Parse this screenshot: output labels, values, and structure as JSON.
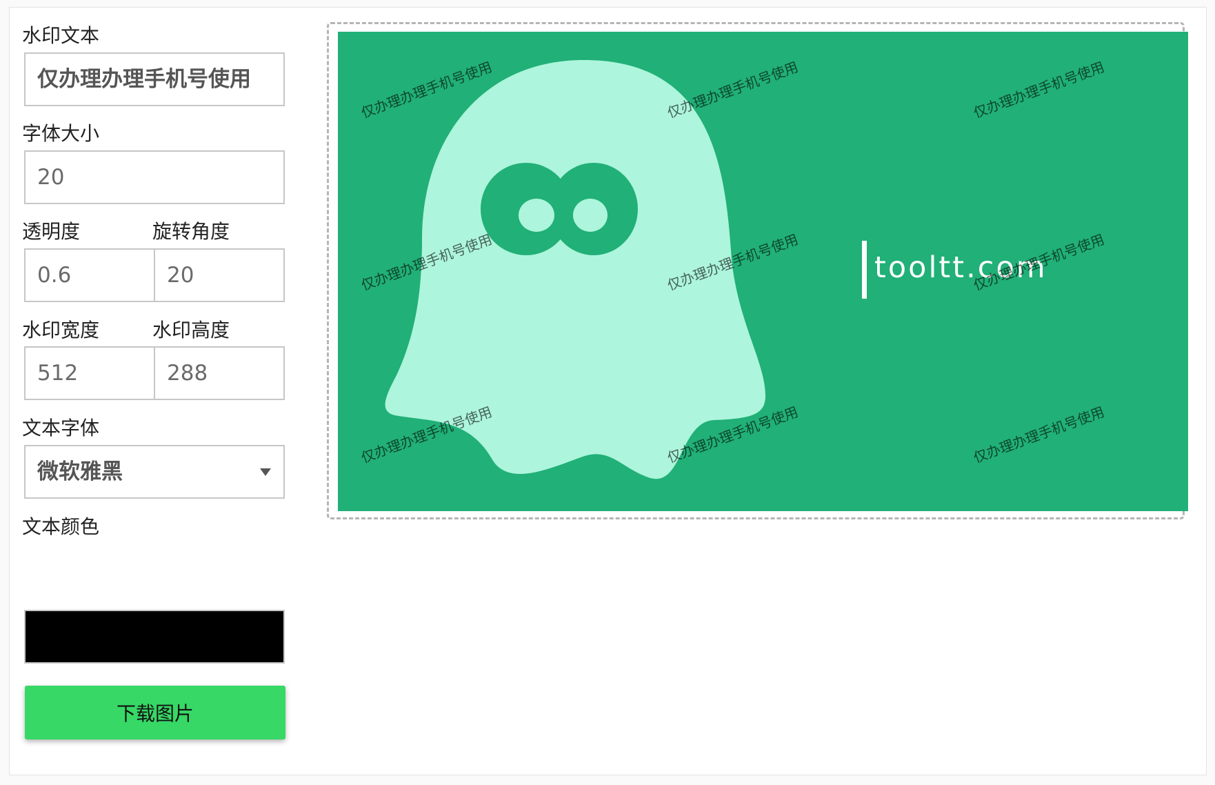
{
  "form": {
    "watermark_text_label": "水印文本",
    "watermark_text_value": "仅办理办理手机号使用",
    "font_size_label": "字体大小",
    "font_size_value": "20",
    "opacity_label": "透明度",
    "opacity_value": "0.6",
    "rotation_label": "旋转角度",
    "rotation_value": "20",
    "width_label": "水印宽度",
    "width_value": "512",
    "height_label": "水印高度",
    "height_value": "288",
    "font_family_label": "文本字体",
    "font_family_value": "微软雅黑",
    "color_label": "文本颜色",
    "color_value": "#000000",
    "download_label": "下载图片"
  },
  "preview": {
    "background_color": "#21b077",
    "ghost_color": "#adf5dc",
    "logo_text": "tooltt.com",
    "watermark_text": "仅办理办理手机号使用",
    "watermark_rotation_deg": -20
  }
}
